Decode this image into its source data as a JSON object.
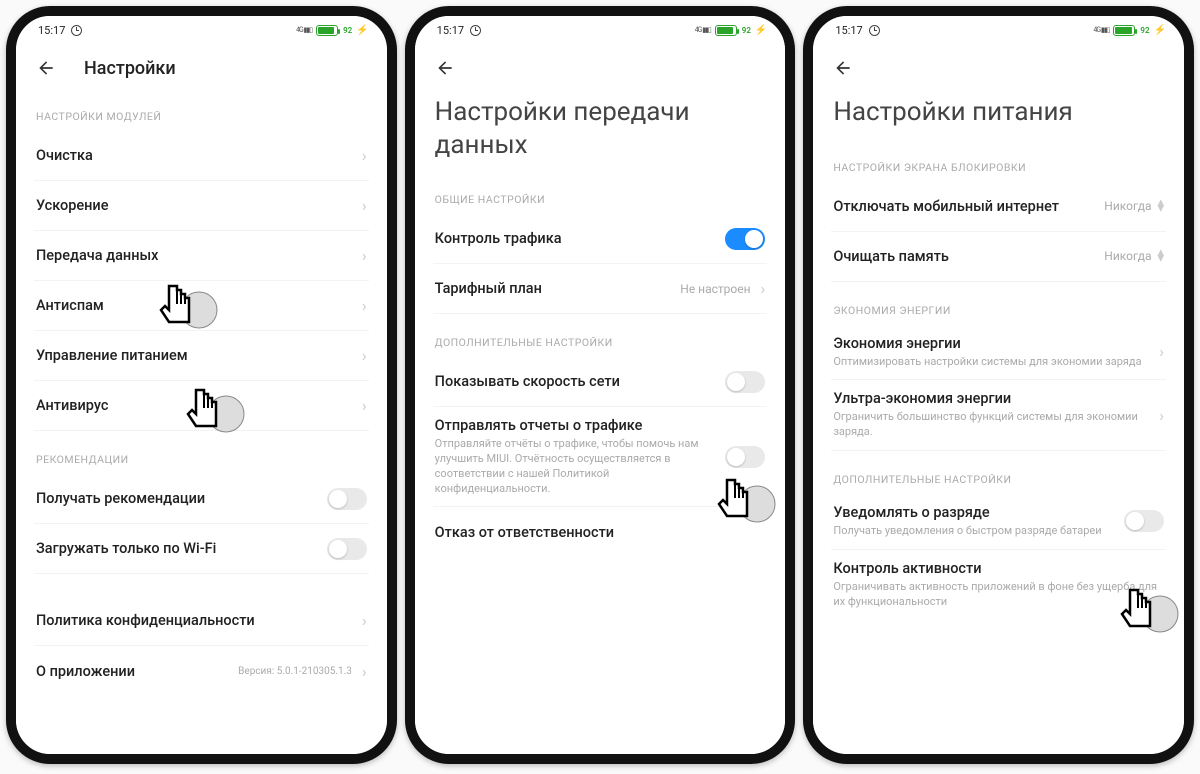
{
  "status": {
    "time": "15:17",
    "battery": "92"
  },
  "phone1": {
    "title": "Настройки",
    "section1": "НАСТРОЙКИ МОДУЛЕЙ",
    "items1": [
      "Очистка",
      "Ускорение",
      "Передача данных",
      "Антиспам",
      "Управление питанием",
      "Антивирус"
    ],
    "section2": "РЕКОМЕНДАЦИИ",
    "receive_recs": "Получать рекомендации",
    "wifi_only": "Загружать только по Wi-Fi",
    "privacy": "Политика конфиденциальности",
    "about": "О приложении",
    "version": "Версия: 5.0.1-210305.1.3"
  },
  "phone2": {
    "title": "Настройки передачи данных",
    "section1": "ОБЩИЕ НАСТРОЙКИ",
    "traffic_control": "Контроль трафика",
    "tariff": "Тарифный план",
    "tariff_value": "Не настроен",
    "section2": "ДОПОЛНИТЕЛЬНЫЕ НАСТРОЙКИ",
    "show_speed": "Показывать скорость сети",
    "send_reports": "Отправлять отчеты о трафике",
    "send_reports_sub": "Отправляйте отчёты о трафике, чтобы помочь нам улучшить MIUI. Отчётность осуществляется в соответствии с нашей Политикой конфиденциальности.",
    "disclaimer": "Отказ от ответственности"
  },
  "phone3": {
    "title": "Настройки питания",
    "section1": "НАСТРОЙКИ ЭКРАНА БЛОКИРОВКИ",
    "disable_mobile": "Отключать мобильный интернет",
    "clear_memory": "Очищать память",
    "never": "Никогда",
    "section2": "ЭКОНОМИЯ ЭНЕРГИИ",
    "energy_save": "Экономия энергии",
    "energy_save_sub": "Оптимизировать настройки системы для экономии заряда",
    "ultra_save": "Ультра-экономия энергии",
    "ultra_save_sub": "Ограничить большинство функций системы для экономии заряда.",
    "section3": "ДОПОЛНИТЕЛЬНЫЕ НАСТРОЙКИ",
    "notify_discharge": "Уведомлять о разряде",
    "notify_discharge_sub": "Получать уведомления о быстром разряде батареи",
    "activity_control": "Контроль активности",
    "activity_control_sub": "Ограничивать активность приложений в фоне без ущерба для их функциональности"
  }
}
